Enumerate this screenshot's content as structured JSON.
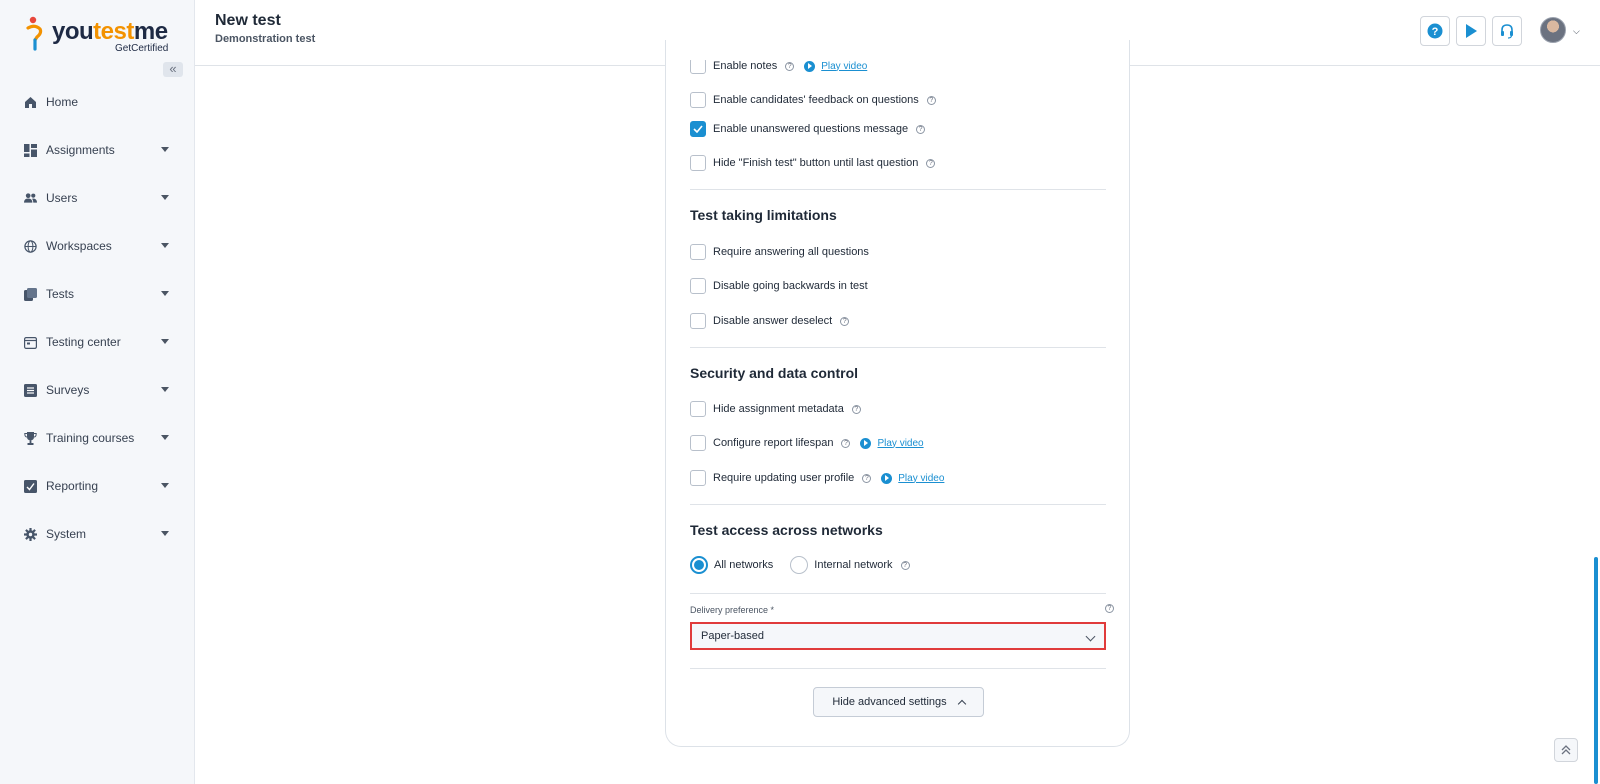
{
  "sidebar": {
    "logo": {
      "part1": "you",
      "part2": "test",
      "part3": "me",
      "sub": "GetCertified"
    },
    "collapse_icon": "«",
    "items": [
      {
        "label": "Home",
        "icon": "home-icon",
        "has_arrow": false
      },
      {
        "label": "Assignments",
        "icon": "dashboard-icon",
        "has_arrow": true
      },
      {
        "label": "Users",
        "icon": "users-icon",
        "has_arrow": true
      },
      {
        "label": "Workspaces",
        "icon": "globe-icon",
        "has_arrow": true
      },
      {
        "label": "Tests",
        "icon": "tests-icon",
        "has_arrow": true
      },
      {
        "label": "Testing center",
        "icon": "calendar-icon",
        "has_arrow": true
      },
      {
        "label": "Surveys",
        "icon": "list-icon",
        "has_arrow": true
      },
      {
        "label": "Training courses",
        "icon": "trophy-icon",
        "has_arrow": true
      },
      {
        "label": "Reporting",
        "icon": "report-icon",
        "has_arrow": true
      },
      {
        "label": "System",
        "icon": "gear-icon",
        "has_arrow": true
      }
    ]
  },
  "header": {
    "title": "New test",
    "subtitle": "Demonstration test",
    "help_icon": "?",
    "accent": "#1a8fd1"
  },
  "settings": {
    "top_rows": [
      {
        "label": "Enable notes",
        "checked": false,
        "info": true,
        "video": "Play video"
      },
      {
        "label": "Enable candidates' feedback on questions",
        "checked": false,
        "info": true
      },
      {
        "label": "Enable unanswered questions message",
        "checked": true,
        "info": true
      },
      {
        "label": "Hide \"Finish test\" button until last question",
        "checked": false,
        "info": true
      }
    ],
    "limitations": {
      "title": "Test taking limitations",
      "rows": [
        {
          "label": "Require answering all questions",
          "checked": false
        },
        {
          "label": "Disable going backwards in test",
          "checked": false
        },
        {
          "label": "Disable answer deselect",
          "checked": false,
          "info": true
        }
      ]
    },
    "security": {
      "title": "Security and data control",
      "rows": [
        {
          "label": "Hide assignment metadata",
          "checked": false,
          "info": true
        },
        {
          "label": "Configure report lifespan",
          "checked": false,
          "info": true,
          "video": "Play video"
        },
        {
          "label": "Require updating user profile",
          "checked": false,
          "info": true,
          "video": "Play video"
        }
      ]
    },
    "networks": {
      "title": "Test access across networks",
      "options": [
        {
          "label": "All networks",
          "selected": true
        },
        {
          "label": "Internal network",
          "selected": false,
          "info": true
        }
      ]
    },
    "delivery": {
      "label": "Delivery preference *",
      "value": "Paper-based"
    },
    "advanced_button": "Hide advanced settings"
  },
  "info_glyph": "?"
}
